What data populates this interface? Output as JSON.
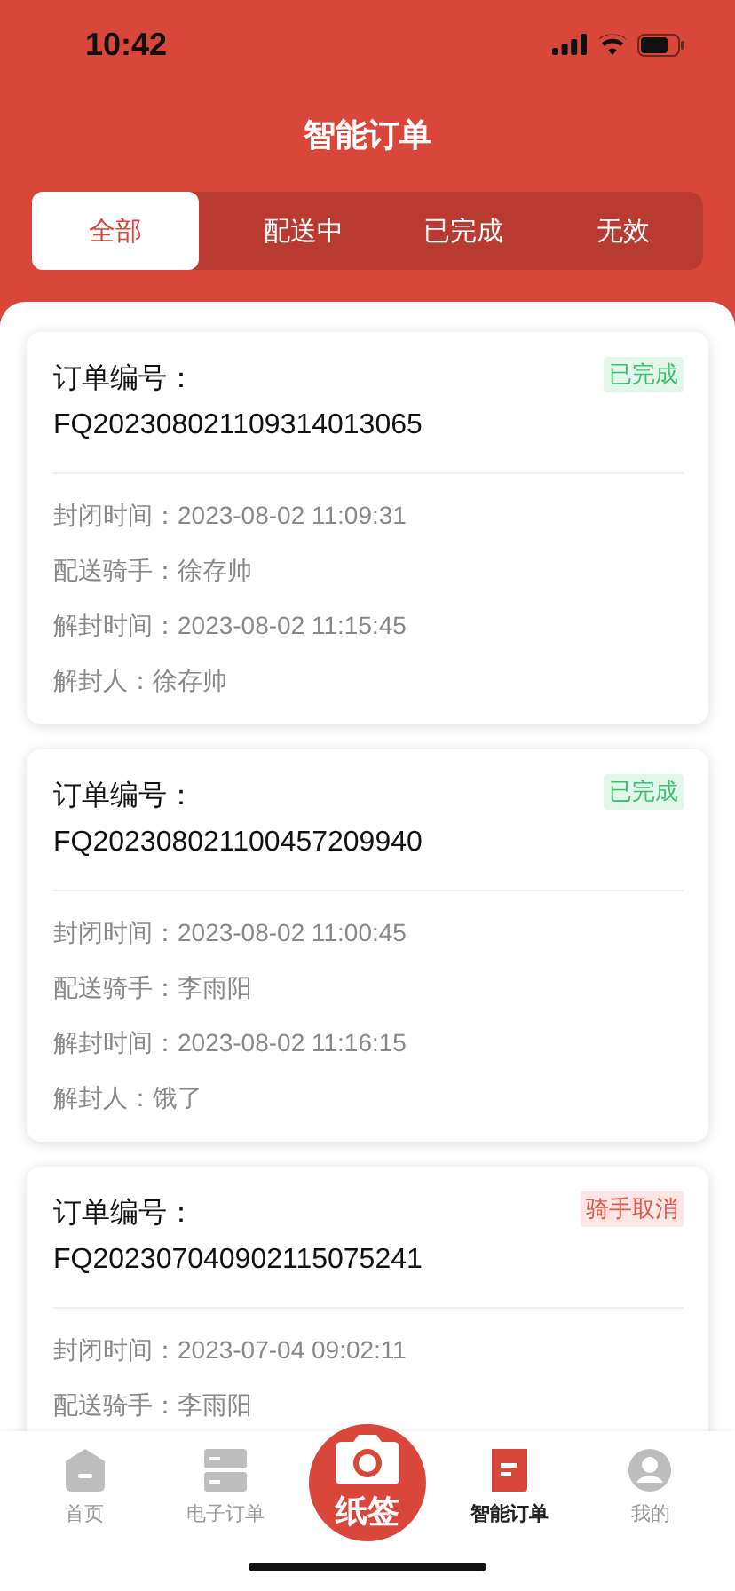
{
  "status_bar": {
    "time": "10:42"
  },
  "header": {
    "title": "智能订单"
  },
  "tabs": [
    {
      "label": "全部",
      "selected": true
    },
    {
      "label": "配送中",
      "selected": false
    },
    {
      "label": "已完成",
      "selected": false
    },
    {
      "label": "无效",
      "selected": false
    }
  ],
  "orders": [
    {
      "label": "订单编号：",
      "number": "FQ202308021109314013065",
      "status": {
        "text": "已完成",
        "kind": "done"
      },
      "fields": [
        "封闭时间：2023-08-02 11:09:31",
        "配送骑手：徐存帅",
        "解封时间：2023-08-02 11:15:45",
        "解封人：徐存帅"
      ]
    },
    {
      "label": "订单编号：",
      "number": "FQ202308021100457209940",
      "status": {
        "text": "已完成",
        "kind": "done"
      },
      "fields": [
        "封闭时间：2023-08-02 11:00:45",
        "配送骑手：李雨阳",
        "解封时间：2023-08-02 11:16:15",
        "解封人：饿了"
      ]
    },
    {
      "label": "订单编号：",
      "number": "FQ202307040902115075241",
      "status": {
        "text": "骑手取消",
        "kind": "cancelled"
      },
      "fields": [
        "封闭时间：2023-07-04 09:02:11",
        "配送骑手：李雨阳"
      ]
    }
  ],
  "tab_bar": [
    {
      "label": "首页",
      "kind": "home",
      "selected": false
    },
    {
      "label": "电子订单",
      "kind": "list",
      "selected": false
    },
    {
      "label": "纸签",
      "kind": "camera"
    },
    {
      "label": "智能订单",
      "kind": "doc",
      "selected": true
    },
    {
      "label": "我的",
      "kind": "user",
      "selected": false
    }
  ]
}
